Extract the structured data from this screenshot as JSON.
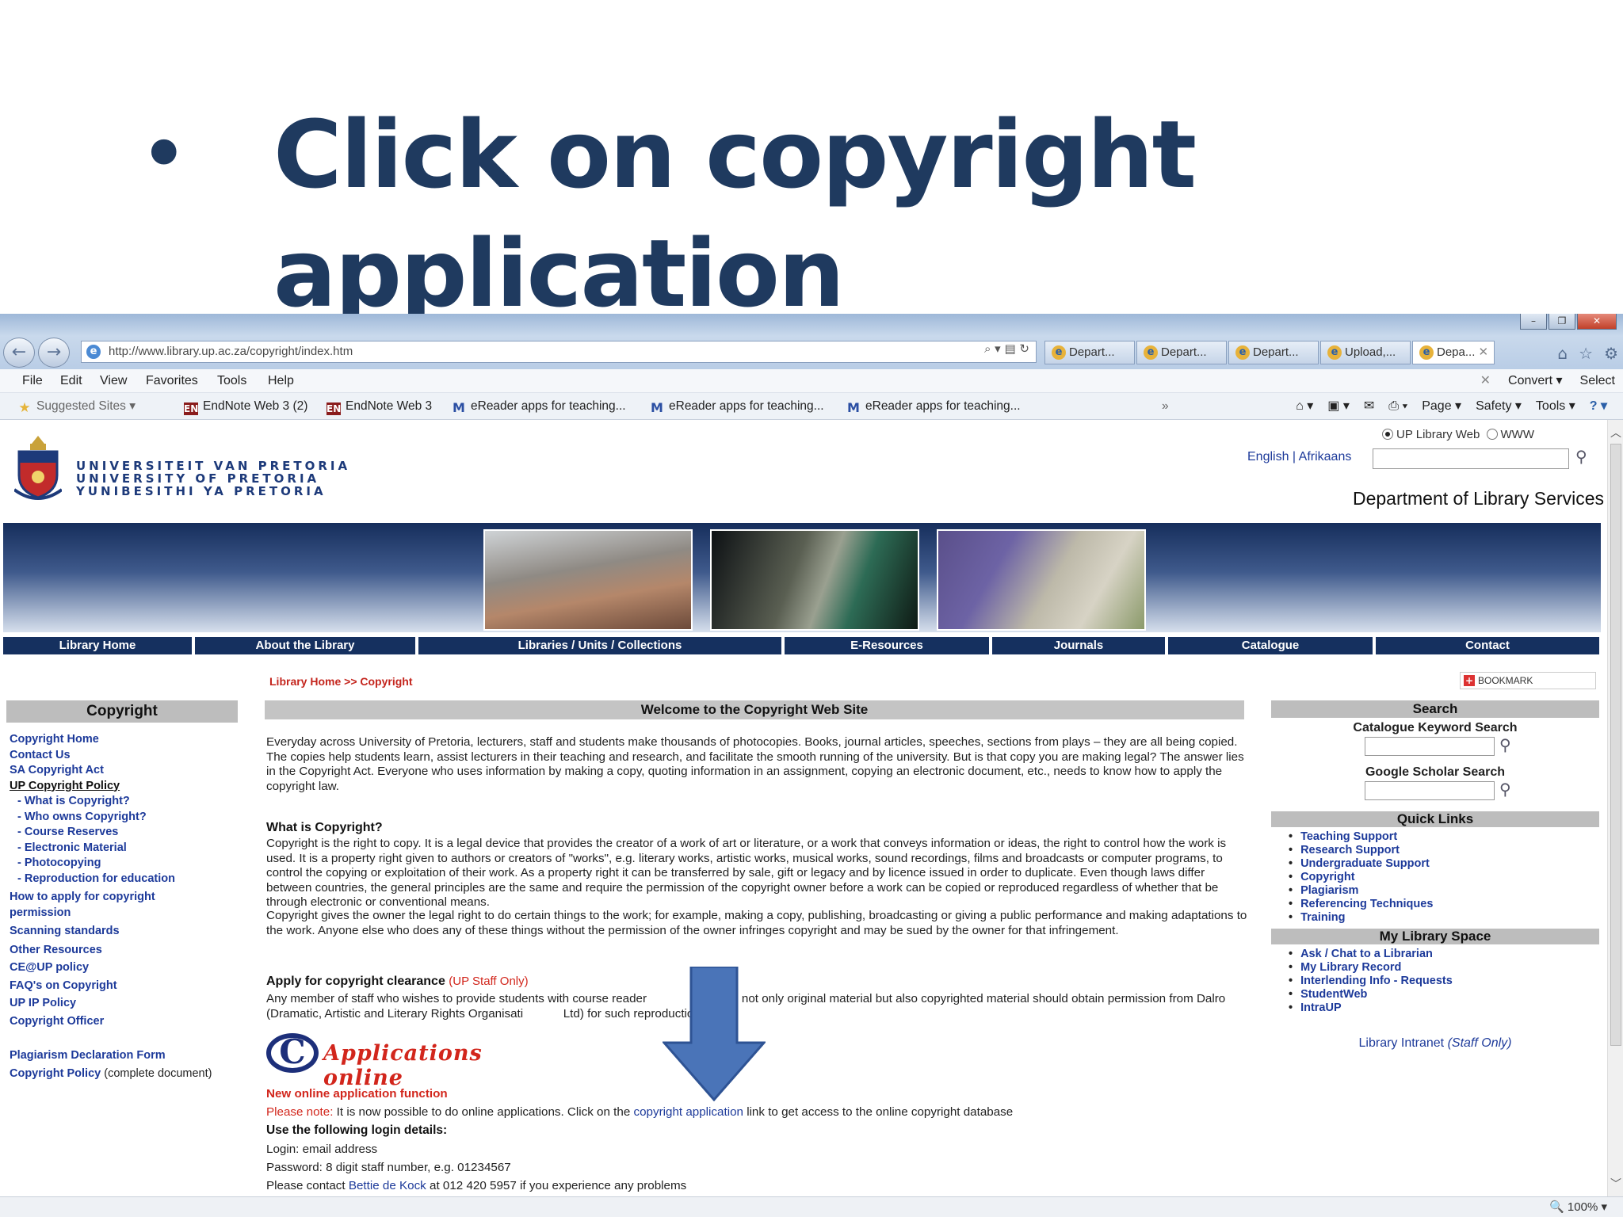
{
  "slide": {
    "bullet": "•",
    "title": "Click on copyright application"
  },
  "browser": {
    "window_buttons": [
      "–",
      "❐",
      "✕"
    ],
    "url": "http://www.library.up.ac.za/copyright/index.htm",
    "address_tools": "⌕ ▾ ▤ ↻",
    "tabs": [
      "Depart...",
      "Depart...",
      "Depart...",
      "Upload,...",
      "Depa..."
    ],
    "tab_close": "✕",
    "tab_icons": [
      "home-icon",
      "favorites-icon",
      "settings-icon"
    ],
    "menu": [
      "File",
      "Edit",
      "View",
      "Favorites",
      "Tools",
      "Help"
    ],
    "menu_right": [
      "✕",
      "Convert ▾",
      "Select"
    ],
    "favorites": [
      "Suggested Sites ▾",
      "EndNote Web 3 (2)",
      "EndNote Web 3",
      "eReader apps for teaching...",
      "eReader apps for teaching...",
      "eReader apps for teaching..."
    ],
    "fav_overflow": "»",
    "commands": [
      "Page ▾",
      "Safety ▾",
      "Tools ▾",
      "? ▾"
    ],
    "zoom": "100%"
  },
  "site": {
    "university": [
      "UNIVERSITEIT VAN PRETORIA",
      "UNIVERSITY OF PRETORIA",
      "YUNIBESITHI YA PRETORIA"
    ],
    "search_scope": [
      "UP Library Web",
      "WWW"
    ],
    "languages": "English | Afrikaans",
    "department": "Department of Library Services",
    "nav": [
      "Library Home",
      "About the Library",
      "Libraries / Units / Collections",
      "E-Resources",
      "Journals",
      "Catalogue",
      "Contact"
    ],
    "breadcrumb": "Library Home >> Copyright",
    "bookmark": "BOOKMARK"
  },
  "left": {
    "heading": "Copyright",
    "items": [
      "Copyright Home",
      "Contact Us",
      "SA Copyright Act",
      "UP Copyright Policy",
      "- What is Copyright?",
      "- Who owns Copyright?",
      "- Course Reserves",
      "- Electronic Material",
      "- Photocopying",
      "- Reproduction for education",
      "How to apply for copyright permission",
      "Scanning standards",
      "Other Resources",
      "CE@UP policy",
      "FAQ's on Copyright",
      "UP IP Policy",
      "Copyright Officer",
      "Plagiarism Declaration Form",
      "Copyright Policy",
      "(complete document)"
    ]
  },
  "main": {
    "heading": "Welcome to the Copyright Web Site",
    "intro": "Everyday across University of Pretoria, lecturers, staff and students make thousands of photocopies. Books, journal articles, speeches, sections from plays – they are all being copied. The copies help students learn, assist lecturers in their teaching and research, and facilitate the smooth running of the university. But is that copy you are making legal? The answer lies in the Copyright Act. Everyone who uses information by making a copy, quoting information in an assignment, copying an electronic document, etc., needs to know how to apply the copyright law.",
    "what_heading": "What is Copyright?",
    "what_p1": "Copyright is the right to copy. It is a legal device that provides the creator of a work of art or literature, or a work that conveys information or ideas, the right to control how the work is used. It is a property right given to authors or creators of \"works\", e.g. literary works, artistic works, musical works, sound recordings, films and broadcasts or computer programs, to control the copying or exploitation of their work. As a property right it can be transferred by sale, gift or legacy and by licence issued in order to duplicate. Even though laws differ between countries, the general principles are the same and require the permission of the copyright owner before a work can be copied or reproduced regardless of whether that be through electronic or conventional means.",
    "what_p2": "Copyright gives the owner the legal right to do certain things to the work; for example, making a copy, publishing, broadcasting or giving a public performance and making adaptations to the work. Anyone else who does any of these things without the permission of the owner infringes copyright and may be sued by the owner for that infringement.",
    "apply_heading": "Apply for copyright clearance",
    "apply_note": "(UP Staff Only)",
    "apply_text": "Any member of staff who wishes to provide students with course reader                include not only original material but also copyrighted material should obtain permission from Dalro (Dramatic, Artistic and Literary Rights Organisati            Ltd) for such reproduction.",
    "logo_c": "C",
    "logo_text": "Applications online",
    "new_function": "New online application function",
    "please_note": "Please note:",
    "note_text_1": " It is now possible to do online applications. Click on the ",
    "copyright_application_link": "copyright application",
    "note_text_2": " link to get access to the online copyright database",
    "login_heading": "Use the following login details:",
    "login": "Login: email address",
    "password": "Password: 8 digit staff number, e.g. 01234567",
    "contact_1": "Please contact ",
    "contact_name": "Bettie de Kock",
    "contact_2": " at 012 420 5957 if you experience any problems"
  },
  "right": {
    "search_heading": "Search",
    "catalogue_label": "Catalogue Keyword Search",
    "scholar_label": "Google Scholar Search",
    "quick_heading": "Quick Links",
    "quick": [
      "Teaching Support",
      "Research Support",
      "Undergraduate Support",
      "Copyright",
      "Plagiarism",
      "Referencing Techniques",
      "Training"
    ],
    "space_heading": "My Library Space",
    "space": [
      "Ask / Chat to a Librarian",
      "My Library Record",
      "Interlending Info - Requests",
      "StudentWeb",
      "IntraUP"
    ],
    "intranet": "Library Intranet",
    "intranet_note": "(Staff Only)"
  },
  "colors": {
    "title": "#1f3a5f",
    "nav_bg": "#15305f",
    "link": "#1d3a9a",
    "red": "#d2261c",
    "arrow": "#4a74b8"
  }
}
